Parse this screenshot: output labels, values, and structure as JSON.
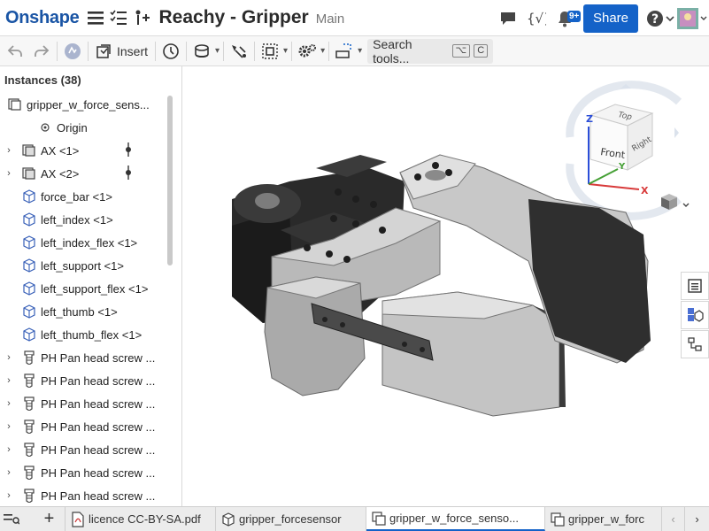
{
  "header": {
    "logo": "Onshape",
    "doc_title": "Reachy - Gripper",
    "branch": "Main",
    "notification_count": "9+",
    "share_label": "Share",
    "help_label": "?"
  },
  "toolbar": {
    "insert_label": "Insert",
    "search_label": "Search tools...",
    "shortcut_1": "⌥",
    "shortcut_2": "C"
  },
  "instances": {
    "header": "Instances (38)",
    "items": [
      {
        "label": "gripper_w_force_sens..."
      },
      {
        "label": "Origin"
      },
      {
        "label": "AX <1>"
      },
      {
        "label": "AX <2>"
      },
      {
        "label": "force_bar <1>"
      },
      {
        "label": "left_index <1>"
      },
      {
        "label": "left_index_flex <1>"
      },
      {
        "label": "left_support <1>"
      },
      {
        "label": "left_support_flex <1>"
      },
      {
        "label": "left_thumb <1>"
      },
      {
        "label": "left_thumb_flex <1>"
      },
      {
        "label": "PH Pan head screw ..."
      },
      {
        "label": "PH Pan head screw ..."
      },
      {
        "label": "PH Pan head screw ..."
      },
      {
        "label": "PH Pan head screw ..."
      },
      {
        "label": "PH Pan head screw ..."
      },
      {
        "label": "PH Pan head screw ..."
      },
      {
        "label": "PH Pan head screw ..."
      }
    ]
  },
  "viewcube": {
    "top": "Top",
    "front": "Front",
    "right": "Right",
    "axis_x": "X",
    "axis_y": "Y",
    "axis_z": "Z"
  },
  "tabs": [
    {
      "label": "licence CC-BY-SA.pdf"
    },
    {
      "label": "gripper_forcesensor"
    },
    {
      "label": "gripper_w_force_senso..."
    },
    {
      "label": "gripper_w_forc"
    }
  ],
  "colors": {
    "brand": "#1a55a5",
    "accent": "#1462c8"
  }
}
